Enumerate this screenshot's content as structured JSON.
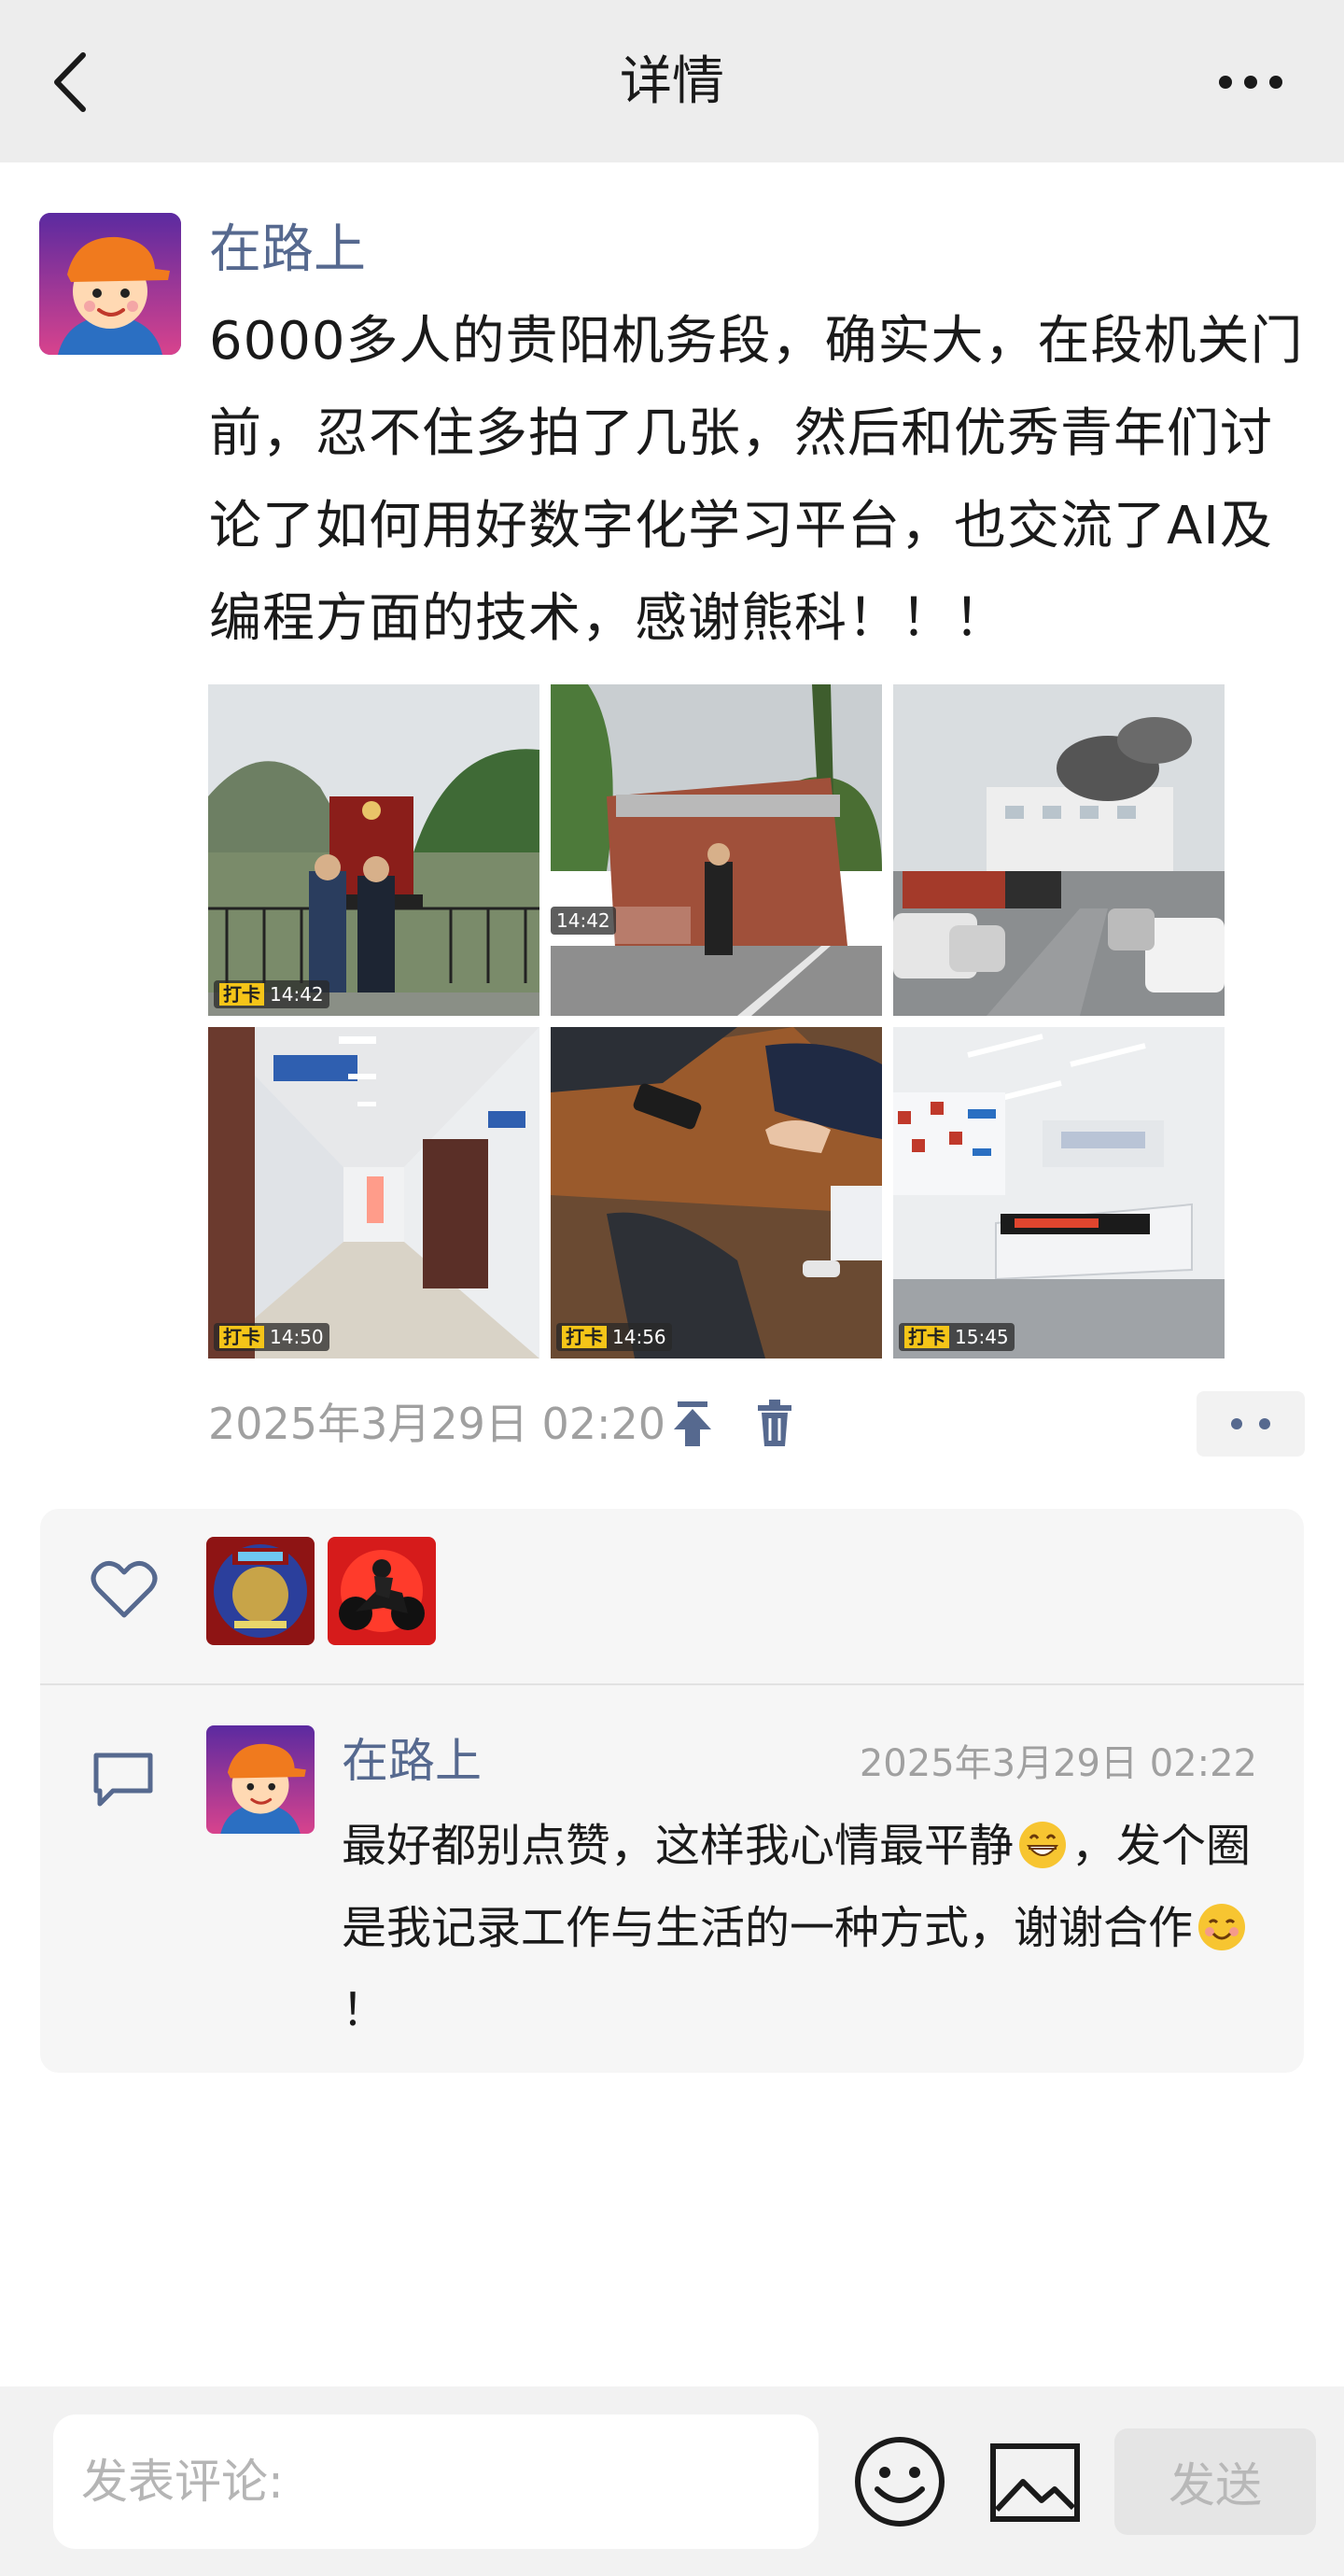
{
  "header": {
    "title": "详情",
    "back_icon": "chevron-left-icon",
    "more_icon": "ellipsis-icon"
  },
  "post": {
    "author": "在路上",
    "text": "6000多人的贵阳机务段，确实大，在段机关门前，忍不住多拍了几张，然后和优秀青年们讨论了如何用好数字化学习平台，也交流了AI及编程方面的技术，感谢熊科！！！",
    "timestamp": "2025年3月29日 02:20",
    "photos": [
      {
        "stamp_tag": "打卡",
        "stamp_time": "14:42",
        "scene": "steam-locomotive-monument"
      },
      {
        "stamp_tag": "",
        "stamp_time": "14:42",
        "scene": "depot-entrance-sign"
      },
      {
        "stamp_tag": "",
        "stamp_time": "",
        "scene": "parking-lot-train"
      },
      {
        "stamp_tag": "打卡",
        "stamp_time": "14:50",
        "scene": "office-corridor"
      },
      {
        "stamp_tag": "打卡",
        "stamp_time": "14:56",
        "scene": "meeting-table"
      },
      {
        "stamp_tag": "打卡",
        "stamp_time": "15:45",
        "scene": "lobby-reception"
      }
    ]
  },
  "likes": {
    "icon": "heart-outline-icon",
    "users": [
      {
        "avatar": "2026-badge-avatar"
      },
      {
        "avatar": "motorcycle-avatar"
      }
    ]
  },
  "comments": [
    {
      "author": "在路上",
      "time": "2025年3月29日 02:22",
      "text_part1": "最好都别点赞，这样我心情最平静",
      "text_part2": "，发个圈是我记录工作与生活的一种方式，谢谢合作",
      "text_part3": "！"
    }
  ],
  "composer": {
    "placeholder": "发表评论:",
    "send_label": "发送",
    "emoji_icon": "smiley-icon",
    "image_icon": "image-icon"
  },
  "colors": {
    "header_bg": "#ededed",
    "name_link": "#56698f",
    "muted_text": "#a0a0a0",
    "panel_bg": "#f6f6f6"
  }
}
